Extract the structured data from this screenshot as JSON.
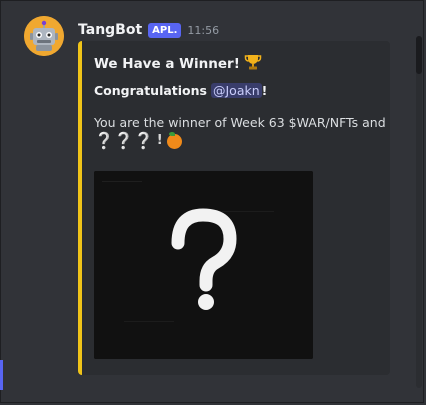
{
  "message": {
    "username": "TangBot",
    "app_tag": "APL.",
    "timestamp": "11:56",
    "avatar_icon": "robot-avatar-icon"
  },
  "embed": {
    "accent_color": "#f0c419",
    "title": "We Have a Winner!",
    "title_icon": "trophy-icon",
    "congrats_label": "Congratulations",
    "mention": "@Joakn",
    "congrats_suffix": "!",
    "body": "You are the winner of Week 63 $WAR/NFTs and",
    "question_marks": "❔❔❔",
    "trailing": "!",
    "trailing_icon": "tangerine-icon",
    "image_icon": "question-mark-icon"
  }
}
